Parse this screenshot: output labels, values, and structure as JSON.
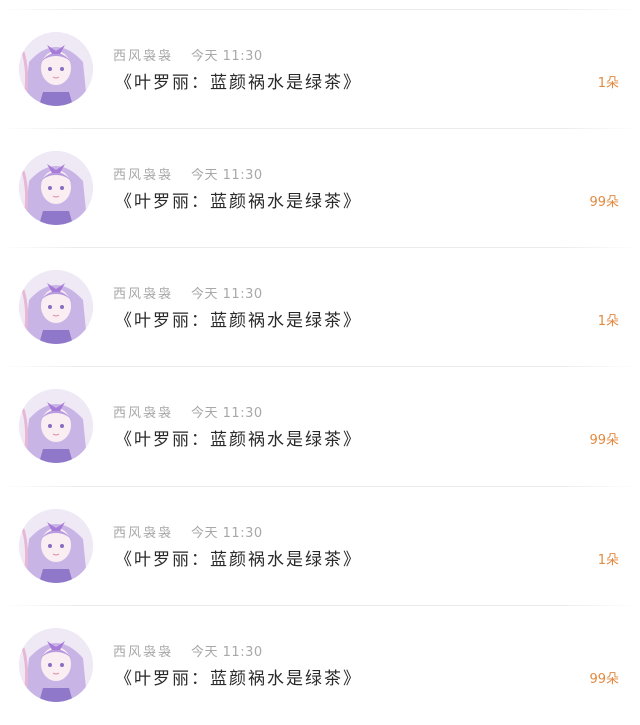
{
  "items": [
    {
      "author": "西风袅袅",
      "time": "今天 11:30",
      "title": "《叶罗丽：蓝颜祸水是绿茶》",
      "flowers": "1朵"
    },
    {
      "author": "西风袅袅",
      "time": "今天 11:30",
      "title": "《叶罗丽：蓝颜祸水是绿茶》",
      "flowers": "99朵"
    },
    {
      "author": "西风袅袅",
      "time": "今天 11:30",
      "title": "《叶罗丽：蓝颜祸水是绿茶》",
      "flowers": "1朵"
    },
    {
      "author": "西风袅袅",
      "time": "今天 11:30",
      "title": "《叶罗丽：蓝颜祸水是绿茶》",
      "flowers": "99朵"
    },
    {
      "author": "西风袅袅",
      "time": "今天 11:30",
      "title": "《叶罗丽：蓝颜祸水是绿茶》",
      "flowers": "1朵"
    },
    {
      "author": "西风袅袅",
      "time": "今天 11:30",
      "title": "《叶罗丽：蓝颜祸水是绿茶》",
      "flowers": "99朵"
    }
  ],
  "colors": {
    "author_text": "#a8a8a8",
    "title_text": "#2a2a2a",
    "flowers_text": "#e08a42",
    "separator": "#ececec"
  },
  "icons": {
    "avatar": "anime-girl-avatar"
  }
}
